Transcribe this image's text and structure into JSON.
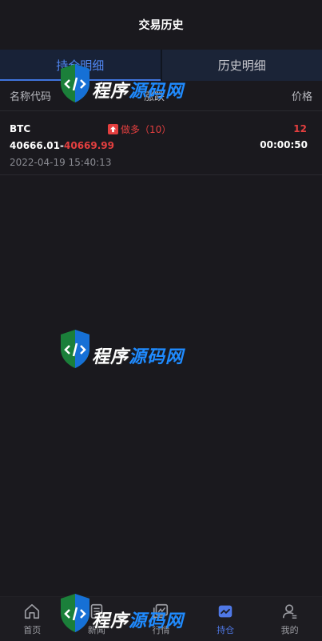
{
  "header": {
    "title": "交易历史"
  },
  "tabs": [
    {
      "label": "持仓明细",
      "active": true
    },
    {
      "label": "历史明细",
      "active": false
    }
  ],
  "columns": {
    "left": "名称代码",
    "mid": "涨跌",
    "right": "价格"
  },
  "positions": [
    {
      "name": "BTC",
      "direction": "做多（10）",
      "quantity": "12",
      "open_price": "40666.01",
      "separator": "-",
      "current_price": "40669.99",
      "timer": "00:00:50",
      "time": "2022-04-19 15:40:13"
    }
  ],
  "watermark": {
    "part_a": "程序",
    "part_b": "源码网"
  },
  "tabbar": {
    "items": [
      {
        "label": "首页",
        "icon": "home-icon"
      },
      {
        "label": "新闻",
        "icon": "news-icon"
      },
      {
        "label": "行情",
        "icon": "chart-icon"
      },
      {
        "label": "持仓",
        "icon": "position-icon",
        "active": true
      },
      {
        "label": "我的",
        "icon": "profile-icon"
      }
    ]
  },
  "colors": {
    "accent": "#4f78e6",
    "down": "#e43f3f",
    "bg": "#1a191e"
  }
}
